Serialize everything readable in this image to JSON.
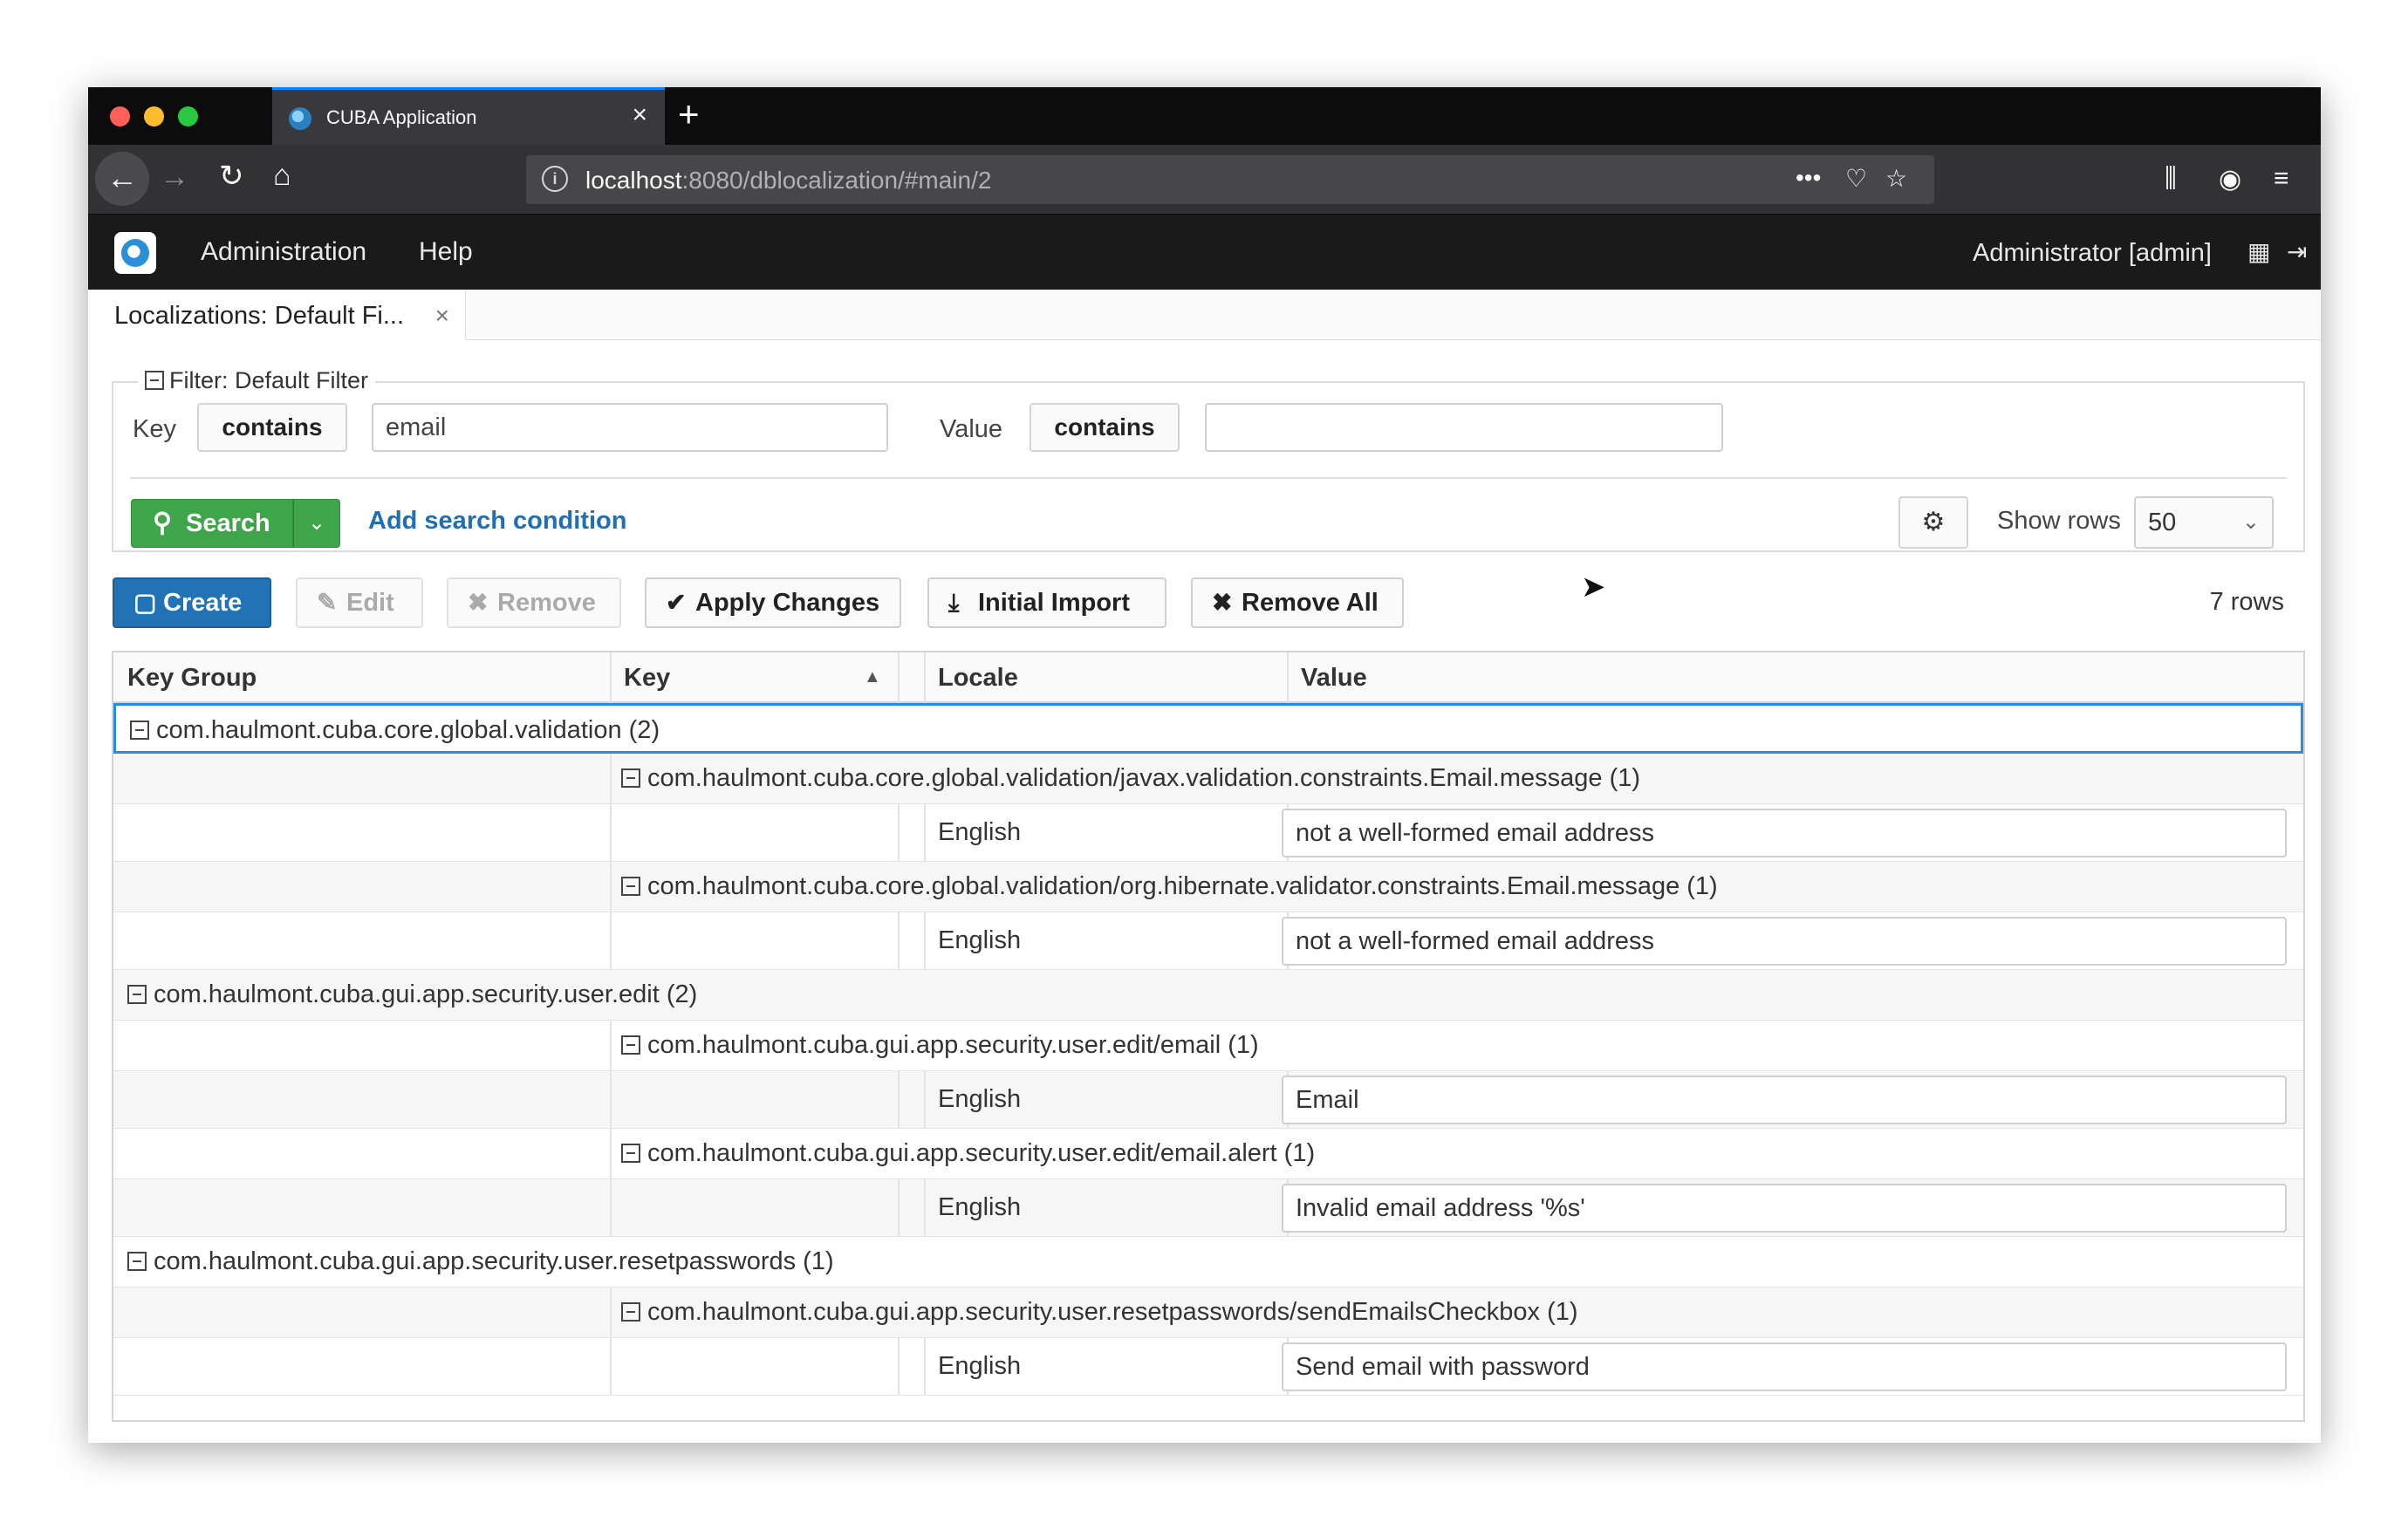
{
  "browser": {
    "tab_title": "CUBA Application",
    "url_host": "localhost",
    "url_rest": ":8080/dblocalization/#main/2"
  },
  "app": {
    "menu": [
      "Administration",
      "Help"
    ],
    "user": "Administrator [admin]",
    "screen_tab": "Localizations: Default Fi..."
  },
  "filter": {
    "legend": "Filter: Default Filter",
    "key_label": "Key",
    "key_op": "contains",
    "key_value": "email",
    "value_label": "Value",
    "value_op": "contains",
    "value_value": "",
    "search_label": "Search",
    "add_condition": "Add search condition",
    "show_rows_label": "Show rows",
    "show_rows_value": "50"
  },
  "toolbar": {
    "create": "Create",
    "edit": "Edit",
    "remove": "Remove",
    "apply": "Apply Changes",
    "import": "Initial Import",
    "remove_all": "Remove All",
    "rows_count": "7 rows"
  },
  "table": {
    "columns": [
      "Key Group",
      "Key",
      "Locale",
      "Value"
    ],
    "rows": [
      {
        "type": "group",
        "text": "com.haulmont.cuba.core.global.validation (2)"
      },
      {
        "type": "key",
        "text": "com.haulmont.cuba.core.global.validation/javax.validation.constraints.Email.message (1)"
      },
      {
        "type": "value",
        "locale": "English",
        "value": "not a well-formed email address"
      },
      {
        "type": "key",
        "text": "com.haulmont.cuba.core.global.validation/org.hibernate.validator.constraints.Email.message (1)"
      },
      {
        "type": "value",
        "locale": "English",
        "value": "not a well-formed email address"
      },
      {
        "type": "group",
        "text": "com.haulmont.cuba.gui.app.security.user.edit (2)"
      },
      {
        "type": "key",
        "text": "com.haulmont.cuba.gui.app.security.user.edit/email (1)"
      },
      {
        "type": "value",
        "locale": "English",
        "value": "Email"
      },
      {
        "type": "key",
        "text": "com.haulmont.cuba.gui.app.security.user.edit/email.alert (1)"
      },
      {
        "type": "value",
        "locale": "English",
        "value": "Invalid email address '%s'"
      },
      {
        "type": "group",
        "text": "com.haulmont.cuba.gui.app.security.user.resetpasswords (1)"
      },
      {
        "type": "key",
        "text": "com.haulmont.cuba.gui.app.security.user.resetpasswords/sendEmailsCheckbox (1)"
      },
      {
        "type": "value",
        "locale": "English",
        "value": "Send email with password"
      }
    ]
  }
}
